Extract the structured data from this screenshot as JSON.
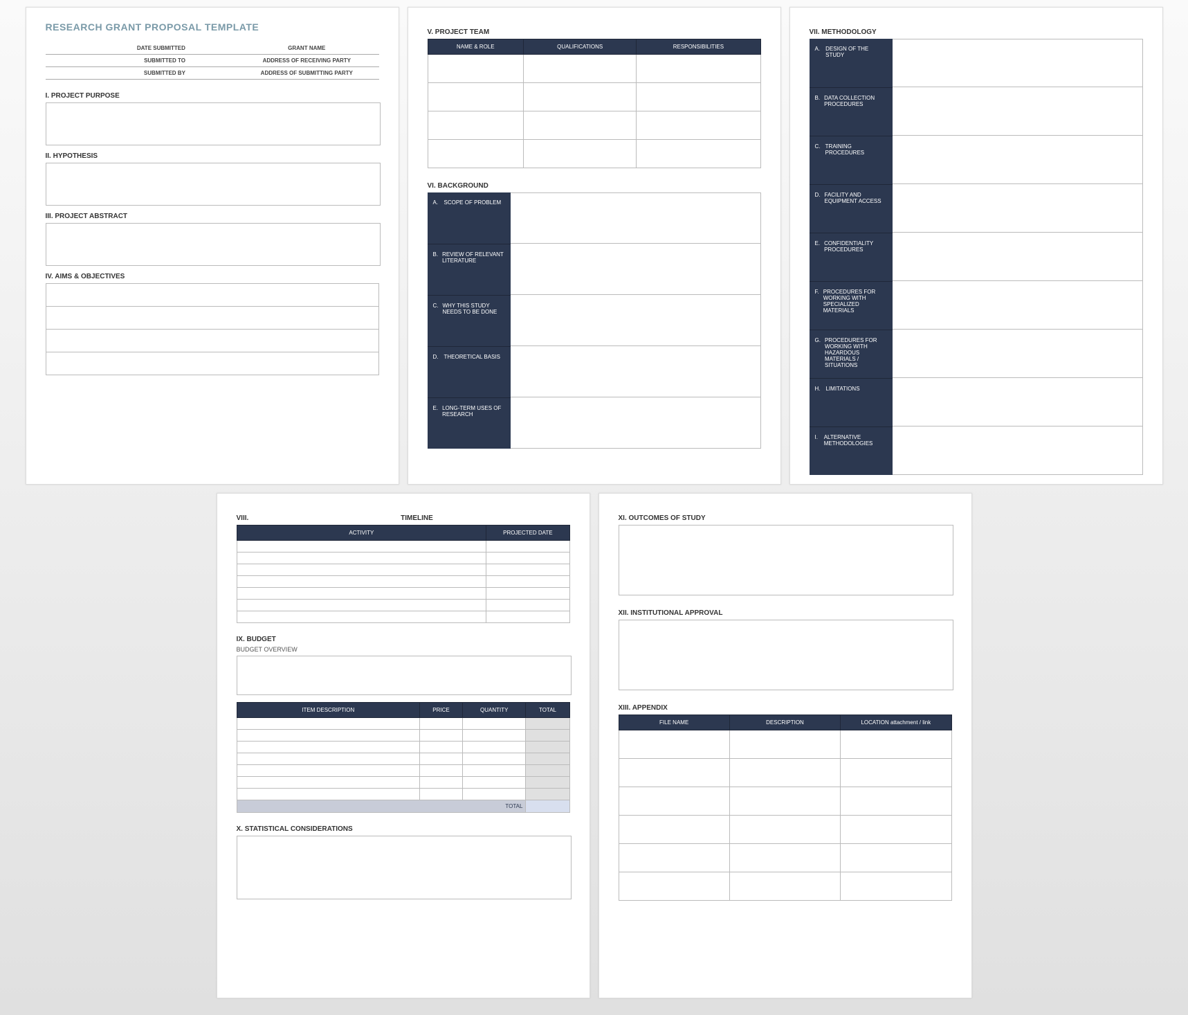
{
  "title": "RESEARCH GRANT PROPOSAL TEMPLATE",
  "meta": {
    "date_submitted_lbl": "DATE SUBMITTED",
    "grant_name_lbl": "GRANT NAME",
    "submitted_to_lbl": "SUBMITTED TO",
    "addr_recv_lbl": "ADDRESS OF RECEIVING PARTY",
    "submitted_by_lbl": "SUBMITTED BY",
    "addr_sub_lbl": "ADDRESS OF SUBMITTING PARTY"
  },
  "sec1": {
    "h": "I.   PROJECT PURPOSE"
  },
  "sec2": {
    "h": "II.  HYPOTHESIS"
  },
  "sec3": {
    "h": "III. PROJECT ABSTRACT"
  },
  "sec4": {
    "h": "IV. AIMS & OBJECTIVES"
  },
  "sec5": {
    "h": "V.  PROJECT TEAM",
    "cols": [
      "NAME & ROLE",
      "QUALIFICATIONS",
      "RESPONSIBILITIES"
    ]
  },
  "sec6": {
    "h": "VI. BACKGROUND",
    "rows": [
      {
        "l": "A.",
        "t": "SCOPE OF PROBLEM"
      },
      {
        "l": "B.",
        "t": "REVIEW OF RELEVANT LITERATURE"
      },
      {
        "l": "C.",
        "t": "WHY THIS STUDY NEEDS TO BE DONE"
      },
      {
        "l": "D.",
        "t": "THEORETICAL BASIS"
      },
      {
        "l": "E.",
        "t": "LONG-TERM USES OF RESEARCH"
      }
    ]
  },
  "sec7": {
    "h": "VII. METHODOLOGY",
    "rows": [
      {
        "l": "A.",
        "t": "DESIGN OF THE STUDY"
      },
      {
        "l": "B.",
        "t": "DATA COLLECTION PROCEDURES"
      },
      {
        "l": "C.",
        "t": "TRAINING PROCEDURES"
      },
      {
        "l": "D.",
        "t": "FACILITY AND EQUIPMENT ACCESS"
      },
      {
        "l": "E.",
        "t": "CONFIDENTIALITY PROCEDURES"
      },
      {
        "l": "F.",
        "t": "PROCEDURES FOR WORKING WITH SPECIALIZED MATERIALS"
      },
      {
        "l": "G.",
        "t": "PROCEDURES FOR WORKING WITH HAZARDOUS MATERIALS / SITUATIONS"
      },
      {
        "l": "H.",
        "t": "LIMITATIONS"
      },
      {
        "l": "I.",
        "t": "ALTERNATIVE METHODOLOGIES"
      }
    ]
  },
  "sec8": {
    "num": "VIII.",
    "h": "TIMELINE",
    "cols": [
      "ACTIVITY",
      "PROJECTED DATE"
    ]
  },
  "sec9": {
    "h": "IX. BUDGET",
    "sub": "BUDGET OVERVIEW",
    "cols": [
      "ITEM DESCRIPTION",
      "PRICE",
      "QUANTITY",
      "TOTAL"
    ],
    "total_lbl": "TOTAL"
  },
  "sec10": {
    "h": "X.   STATISTICAL CONSIDERATIONS"
  },
  "sec11": {
    "h": "XI.  OUTCOMES OF STUDY"
  },
  "sec12": {
    "h": "XII. INSTITUTIONAL APPROVAL"
  },
  "sec13": {
    "h": "XIII. APPENDIX",
    "cols": [
      "FILE NAME",
      "DESCRIPTION",
      "LOCATION attachment / link"
    ]
  }
}
